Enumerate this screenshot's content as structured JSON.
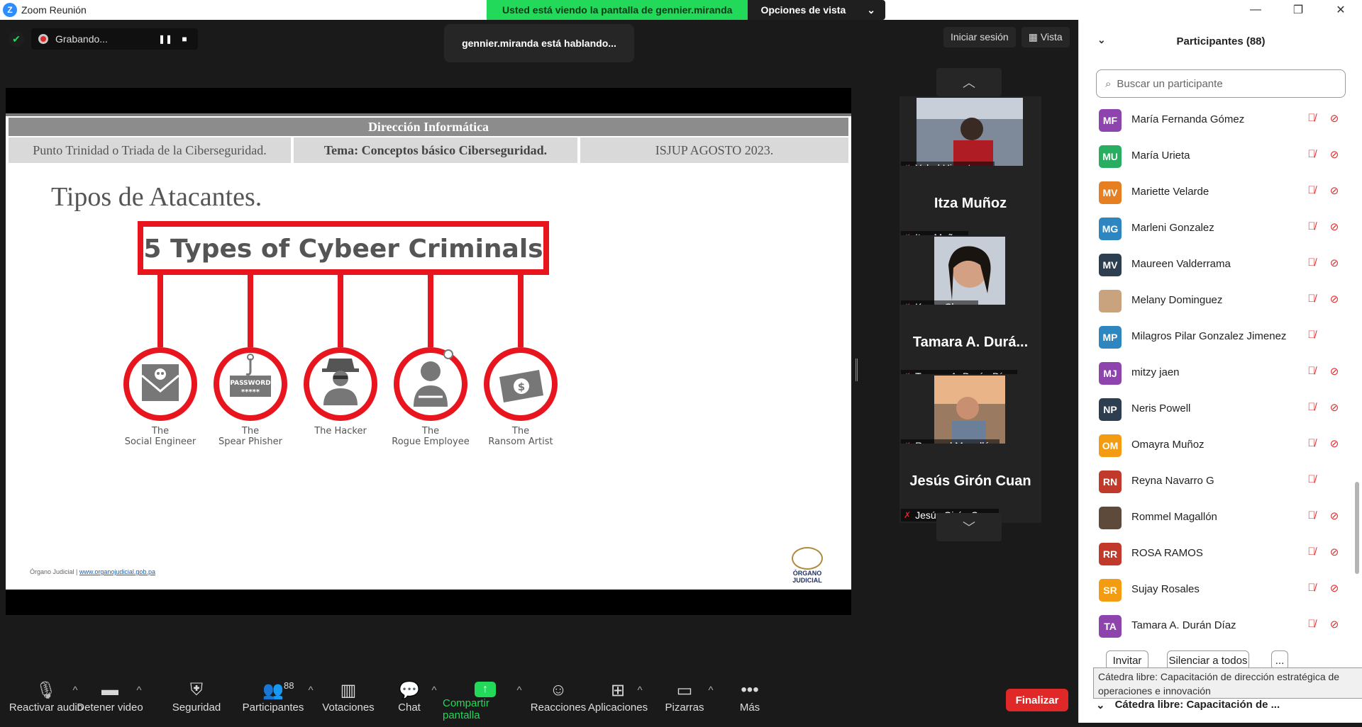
{
  "window": {
    "title": "Zoom Reunión",
    "controls": [
      "—",
      "❐",
      "✕"
    ]
  },
  "view_banner": {
    "status": "Usted está viendo la pantalla de gennier.miranda",
    "options_label": "Opciones de vista"
  },
  "recording": {
    "label": "Grabando..."
  },
  "speaking": "gennier.miranda está hablando...",
  "topbar": {
    "signin": "Iniciar sesión",
    "view": "Vista"
  },
  "slide": {
    "header": "Dirección Informática",
    "sub": [
      "Punto Trinidad o Triada de la Ciberseguridad.",
      "Tema: Conceptos básico Ciberseguridad.",
      "ISJUP AGOSTO 2023."
    ],
    "title": "Tipos de Atacantes.",
    "infographic_title": "5 Types of Cybeer Criminals",
    "types": [
      {
        "line1": "The",
        "line2": "Social Engineer"
      },
      {
        "line1": "The",
        "line2": "Spear Phisher"
      },
      {
        "line1": "The Hacker",
        "line2": ""
      },
      {
        "line1": "The",
        "line2": "Rogue Employee"
      },
      {
        "line1": "The",
        "line2": "Ransom Artist"
      }
    ],
    "password_text": "PASSWORD",
    "password_mask": "*****",
    "dollar": "$",
    "footer_org": "Órgano Judicial |",
    "footer_link": "www.organojudicial.gob.pa",
    "logo_text": "ÓRGANO JUDICIAL",
    "accent": "#e8141e"
  },
  "gallery": [
    {
      "name": "Yahel Hinestroza",
      "big": "",
      "photo": true
    },
    {
      "name": "Itza Muñoz",
      "big": "Itza Muñoz",
      "photo": false
    },
    {
      "name": "Karen Chong",
      "big": "",
      "photo": true
    },
    {
      "name": "Tamara A. Durán Díaz",
      "big": "Tamara A. Durá...",
      "photo": false
    },
    {
      "name": "Rommel Magallón",
      "big": "",
      "photo": true
    },
    {
      "name": "Jesús Girón Cuan",
      "big": "Jesús Girón Cuan",
      "photo": false
    }
  ],
  "toolbar": {
    "unmute": "Reactivar audio",
    "stop_video": "Detener video",
    "security": "Seguridad",
    "participants": "Participantes",
    "participants_count": "88",
    "polls": "Votaciones",
    "chat": "Chat",
    "share": "Compartir pantalla",
    "reactions": "Reacciones",
    "apps": "Aplicaciones",
    "whiteboards": "Pizarras",
    "more": "Más",
    "end": "Finalizar"
  },
  "panel": {
    "title": "Participantes (88)",
    "search_placeholder": "Buscar un participante",
    "participants": [
      {
        "initials": "MF",
        "name": "María Fernanda Gómez",
        "color": "#8e44ad",
        "video": true
      },
      {
        "initials": "MU",
        "name": "María Urieta",
        "color": "#27ae60",
        "video": true
      },
      {
        "initials": "MV",
        "name": "Mariette Velarde",
        "color": "#e67e22",
        "video": true
      },
      {
        "initials": "MG",
        "name": "Marleni Gonzalez",
        "color": "#2e86c1",
        "video": true
      },
      {
        "initials": "MV",
        "name": "Maureen Valderrama",
        "color": "#2c3e50",
        "video": true
      },
      {
        "initials": "",
        "name": "Melany Dominguez",
        "color": "#c9a27e",
        "video": true
      },
      {
        "initials": "MP",
        "name": "Milagros Pilar Gonzalez Jimenez",
        "color": "#2e86c1",
        "video": false
      },
      {
        "initials": "MJ",
        "name": "mitzy jaen",
        "color": "#8e44ad",
        "video": true
      },
      {
        "initials": "NP",
        "name": "Neris Powell",
        "color": "#2c3e50",
        "video": true
      },
      {
        "initials": "OM",
        "name": "Omayra Muñoz",
        "color": "#f39c12",
        "video": true
      },
      {
        "initials": "RN",
        "name": "Reyna Navarro G",
        "color": "#c0392b",
        "video": false
      },
      {
        "initials": "",
        "name": "Rommel Magallón",
        "color": "#5d4a3a",
        "video": true
      },
      {
        "initials": "RR",
        "name": "ROSA RAMOS",
        "color": "#c0392b",
        "video": true
      },
      {
        "initials": "SR",
        "name": "Sujay Rosales",
        "color": "#f39c12",
        "video": true
      },
      {
        "initials": "TA",
        "name": "Tamara A. Durán Díaz",
        "color": "#8e44ad",
        "video": true
      }
    ],
    "invite": "Invitar",
    "mute_all": "Silenciar a todos",
    "more": "...",
    "tooltip": "Cátedra libre: Capacitación de dirección estratégica de operaciones e innovación",
    "section": "Cátedra libre: Capacitación de ..."
  }
}
